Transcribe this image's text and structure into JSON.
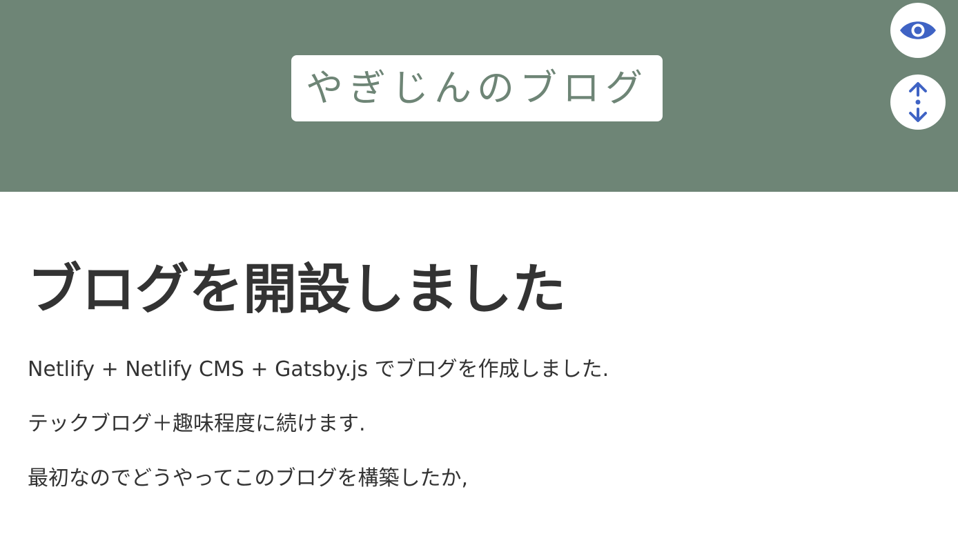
{
  "header": {
    "site_title": "やぎじんのブログ",
    "background_color": "#6e8576"
  },
  "floating_buttons": {
    "preview_icon": "eye-icon",
    "scroll_icon": "scroll-up-down-icon",
    "icon_color": "#3f63c4"
  },
  "article": {
    "title": "ブログを開設しました",
    "paragraphs": [
      "Netlify + Netlify CMS + Gatsby.js でブログを作成しました.",
      "テックブログ＋趣味程度に続けます.",
      "最初なのでどうやってこのブログを構築したか,"
    ]
  }
}
